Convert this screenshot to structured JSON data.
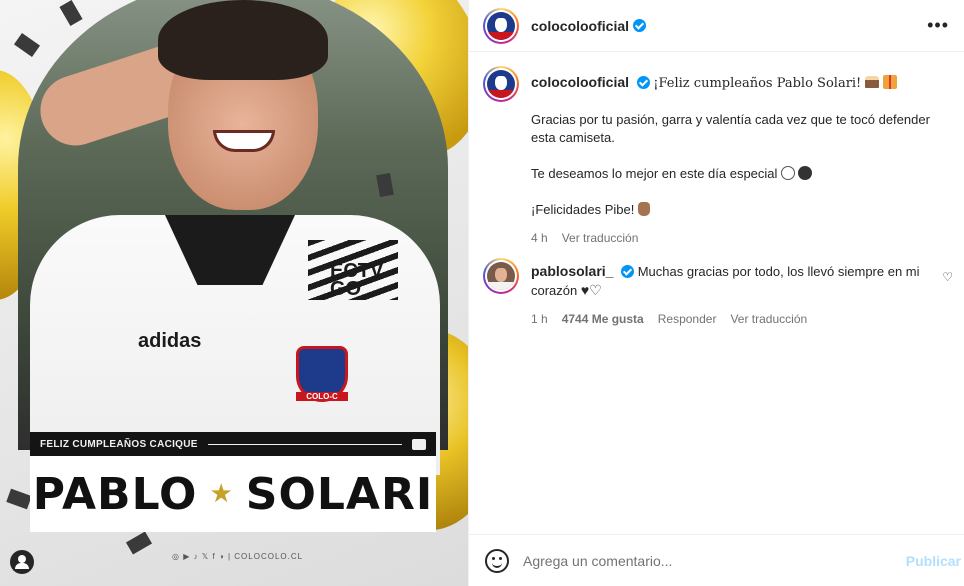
{
  "post_image": {
    "banner_kicker": "FELIZ CUMPLEAÑOS CACIQUE",
    "name_first": "PABLO",
    "name_last": "SOLARI",
    "jersey_sponsor": "ECTV\nGO",
    "jersey_brand": "adidas",
    "crest_label": "COLO-C",
    "footer_social": "◎ ▶ ♪ 𝕏 f ◑ | COLOCOLO.CL"
  },
  "header": {
    "username": "colocolooficial",
    "more_icon": "more-horizontal-icon"
  },
  "caption": {
    "username": "colocolooficial",
    "title": "¡Feliz cumpleaños Pablo Solari!",
    "paragraph_1": "Gracias por tu pasión, garra y valentía cada vez que te tocó defender esta camiseta.",
    "paragraph_2": "Te deseamos lo mejor en este día especial",
    "paragraph_3": "¡Felicidades Pibe!",
    "time": "4 h",
    "see_translation": "Ver traducción"
  },
  "comment": {
    "username": "pablosolari_",
    "text": "Muchas gracias por todo, los llevó siempre en mi corazón",
    "time": "1 h",
    "likes": "4744 Me gusta",
    "reply": "Responder",
    "see_translation": "Ver traducción"
  },
  "composer": {
    "placeholder": "Agrega un comentario...",
    "publish": "Publicar"
  },
  "colors": {
    "verified": "#0095f6",
    "publish_disabled": "#b2dffc",
    "text_primary": "#262626",
    "text_secondary": "#737373",
    "banner_dark": "#141414",
    "gold_star": "#c8a12a"
  }
}
